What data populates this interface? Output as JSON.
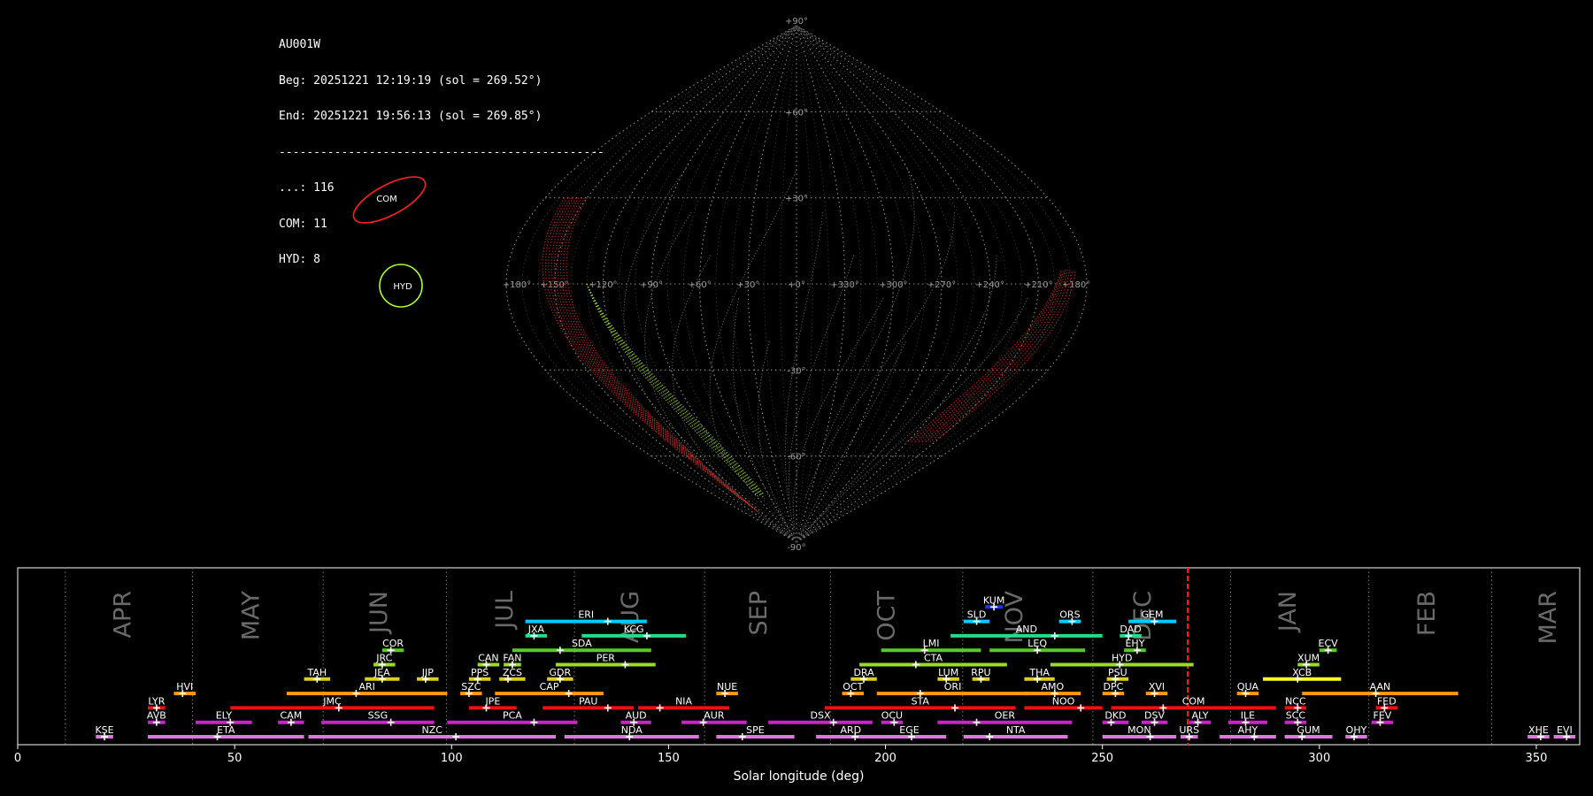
{
  "info": {
    "station": "AU001W",
    "begin": "Beg: 20251221 12:19:19 (sol = 269.52°)",
    "end": "End: 20251221 19:56:13 (sol = 269.85°)",
    "separator": "-----------------------------------------------",
    "counts": [
      "...: 116",
      "COM: 11",
      "HYD: 8"
    ]
  },
  "sky_map": {
    "projection": "sinusoidal",
    "lat_labels": [
      "+90°",
      "+60°",
      "+30°",
      "-30°",
      "-60°",
      "-90°"
    ],
    "lon_labels": [
      "+180°",
      "+150°",
      "+120°",
      "+90°",
      "+60°",
      "+30°",
      "+0°",
      "+330°",
      "+300°",
      "+270°",
      "+240°",
      "+210°",
      "+180°"
    ],
    "radiants": [
      {
        "name": "COM",
        "color": "#ff2020"
      },
      {
        "name": "HYD",
        "color": "#aaff33"
      }
    ]
  },
  "chart_data": {
    "type": "gantt",
    "xlabel": "Solar longitude (deg)",
    "xlim": [
      0,
      360
    ],
    "xticks": [
      0,
      50,
      100,
      150,
      200,
      250,
      300,
      350
    ],
    "current_sol": 269.68,
    "months": [
      {
        "name": "APR",
        "label_x": 24.5,
        "boundary": 11
      },
      {
        "name": "MAY",
        "label_x": 54,
        "boundary": 40.3
      },
      {
        "name": "JUN",
        "label_x": 83.5,
        "boundary": 70.4
      },
      {
        "name": "JUL",
        "label_x": 112.5,
        "boundary": 98.8
      },
      {
        "name": "AUG",
        "label_x": 141.5,
        "boundary": 128.3
      },
      {
        "name": "SEP",
        "label_x": 171,
        "boundary": 158.3
      },
      {
        "name": "OCT",
        "label_x": 200.5,
        "boundary": 187.3
      },
      {
        "name": "NOV",
        "label_x": 230,
        "boundary": 217.8
      },
      {
        "name": "DEC",
        "label_x": 259.5,
        "boundary": 247.8
      },
      {
        "name": "JAN",
        "label_x": 293,
        "boundary": 279.5
      },
      {
        "name": "FEB",
        "label_x": 325,
        "boundary": 311.4
      },
      {
        "name": "MAR",
        "label_x": 353,
        "boundary": 339.7
      }
    ],
    "showers": [
      {
        "code": "KUM",
        "row": 9,
        "start": 223,
        "end": 227,
        "peak": 225,
        "color": "#2233ff"
      },
      {
        "code": "ERI",
        "row": 8,
        "start": 117,
        "end": 145,
        "peak": 136,
        "color": "#00ccff"
      },
      {
        "code": "SLD",
        "row": 8,
        "start": 218,
        "end": 224,
        "peak": 221,
        "color": "#00ccff"
      },
      {
        "code": "ORS",
        "row": 8,
        "start": 240,
        "end": 245,
        "peak": 243,
        "color": "#00ccff"
      },
      {
        "code": "GEM",
        "row": 8,
        "start": 256,
        "end": 267,
        "peak": 262,
        "color": "#00ccff"
      },
      {
        "code": "JXA",
        "row": 7,
        "start": 117,
        "end": 122,
        "peak": 119,
        "color": "#22dd88"
      },
      {
        "code": "KCG",
        "row": 7,
        "start": 130,
        "end": 154,
        "peak": 145,
        "color": "#22dd88"
      },
      {
        "code": "AND",
        "row": 7,
        "start": 215,
        "end": 250,
        "peak": 239,
        "color": "#22dd88"
      },
      {
        "code": "DAD",
        "row": 7,
        "start": 254,
        "end": 259,
        "peak": 256,
        "color": "#22dd88"
      },
      {
        "code": "COR",
        "row": 6,
        "start": 84,
        "end": 89,
        "peak": 86,
        "color": "#55cc22"
      },
      {
        "code": "SDA",
        "row": 6,
        "start": 114,
        "end": 146,
        "peak": 125,
        "color": "#55cc22"
      },
      {
        "code": "LMI",
        "row": 6,
        "start": 199,
        "end": 222,
        "peak": 209,
        "color": "#55cc22"
      },
      {
        "code": "LEQ",
        "row": 6,
        "start": 224,
        "end": 246,
        "peak": 235,
        "color": "#55cc22"
      },
      {
        "code": "EHY",
        "row": 6,
        "start": 255,
        "end": 260,
        "peak": 258,
        "color": "#55cc22"
      },
      {
        "code": "ECV",
        "row": 6,
        "start": 300,
        "end": 304,
        "peak": 302,
        "color": "#55cc22"
      },
      {
        "code": "JRC",
        "row": 5,
        "start": 82,
        "end": 87,
        "peak": 84,
        "color": "#99dd22"
      },
      {
        "code": "CAN",
        "row": 5,
        "start": 106,
        "end": 111,
        "peak": 108,
        "color": "#99dd22"
      },
      {
        "code": "FAN",
        "row": 5,
        "start": 112,
        "end": 116,
        "peak": 114,
        "color": "#99dd22"
      },
      {
        "code": "PER",
        "row": 5,
        "start": 124,
        "end": 147,
        "peak": 140,
        "color": "#99dd22"
      },
      {
        "code": "CTA",
        "row": 5,
        "start": 194,
        "end": 228,
        "peak": 207,
        "color": "#99dd22"
      },
      {
        "code": "HYD",
        "row": 5,
        "start": 238,
        "end": 271,
        "peak": 254,
        "color": "#99dd22"
      },
      {
        "code": "XUM",
        "row": 5,
        "start": 295,
        "end": 300,
        "peak": 297,
        "color": "#99dd22"
      },
      {
        "code": "TAH",
        "row": 4,
        "start": 66,
        "end": 72,
        "peak": 69,
        "color": "#ddcc22"
      },
      {
        "code": "JEA",
        "row": 4,
        "start": 80,
        "end": 88,
        "peak": 84,
        "color": "#ddcc22"
      },
      {
        "code": "JIP",
        "row": 4,
        "start": 92,
        "end": 97,
        "peak": 94,
        "color": "#ddcc22"
      },
      {
        "code": "PPS",
        "row": 4,
        "start": 104,
        "end": 109,
        "peak": 106,
        "color": "#ddcc22"
      },
      {
        "code": "ZCS",
        "row": 4,
        "start": 111,
        "end": 117,
        "peak": 113,
        "color": "#ddcc22"
      },
      {
        "code": "GDR",
        "row": 4,
        "start": 122,
        "end": 128,
        "peak": 125,
        "color": "#ddcc22"
      },
      {
        "code": "DRA",
        "row": 4,
        "start": 192,
        "end": 198,
        "peak": 195,
        "color": "#ddcc22"
      },
      {
        "code": "LUM",
        "row": 4,
        "start": 212,
        "end": 217,
        "peak": 214,
        "color": "#ddcc22"
      },
      {
        "code": "RPU",
        "row": 4,
        "start": 220,
        "end": 224,
        "peak": 222,
        "color": "#ddcc22"
      },
      {
        "code": "THA",
        "row": 4,
        "start": 232,
        "end": 239,
        "peak": 235,
        "color": "#ddcc22"
      },
      {
        "code": "PSU",
        "row": 4,
        "start": 251,
        "end": 256,
        "peak": 253,
        "color": "#ddcc22"
      },
      {
        "code": "XCB",
        "row": 4,
        "start": 287,
        "end": 305,
        "peak": 295,
        "color": "#ffff22"
      },
      {
        "code": "HVI",
        "row": 3,
        "start": 36,
        "end": 41,
        "peak": 38,
        "color": "#ff9911"
      },
      {
        "code": "ARI",
        "row": 3,
        "start": 62,
        "end": 99,
        "peak": 78,
        "color": "#ff9911"
      },
      {
        "code": "SZC",
        "row": 3,
        "start": 102,
        "end": 107,
        "peak": 104,
        "color": "#ff9911"
      },
      {
        "code": "CAP",
        "row": 3,
        "start": 110,
        "end": 135,
        "peak": 127,
        "color": "#ff9911"
      },
      {
        "code": "NUE",
        "row": 3,
        "start": 161,
        "end": 166,
        "peak": 163,
        "color": "#ff9911"
      },
      {
        "code": "OCT",
        "row": 3,
        "start": 190,
        "end": 195,
        "peak": 192,
        "color": "#ff9911"
      },
      {
        "code": "ORI",
        "row": 3,
        "start": 198,
        "end": 233,
        "peak": 208,
        "color": "#ff9911"
      },
      {
        "code": "AMO",
        "row": 3,
        "start": 232,
        "end": 245,
        "peak": 239,
        "color": "#ff9911"
      },
      {
        "code": "DPC",
        "row": 3,
        "start": 250,
        "end": 255,
        "peak": 253,
        "color": "#ff9911"
      },
      {
        "code": "XVI",
        "row": 3,
        "start": 260,
        "end": 265,
        "peak": 262,
        "color": "#ff9911"
      },
      {
        "code": "QUA",
        "row": 3,
        "start": 281,
        "end": 286,
        "peak": 283,
        "color": "#ff9911"
      },
      {
        "code": "AAN",
        "row": 3,
        "start": 296,
        "end": 332,
        "peak": 313,
        "color": "#ff9911"
      },
      {
        "code": "LYR",
        "row": 2,
        "start": 30,
        "end": 34,
        "peak": 32,
        "color": "#ee1111"
      },
      {
        "code": "JMC",
        "row": 2,
        "start": 49,
        "end": 96,
        "peak": 74,
        "color": "#ee1111"
      },
      {
        "code": "JPE",
        "row": 2,
        "start": 104,
        "end": 115,
        "peak": 108,
        "color": "#ee1111"
      },
      {
        "code": "PAU",
        "row": 2,
        "start": 121,
        "end": 142,
        "peak": 136,
        "color": "#ee1111"
      },
      {
        "code": "NIA",
        "row": 2,
        "start": 143,
        "end": 164,
        "peak": 148,
        "color": "#ee1111"
      },
      {
        "code": "STA",
        "row": 2,
        "start": 186,
        "end": 230,
        "peak": 216,
        "color": "#ee1111"
      },
      {
        "code": "NOO",
        "row": 2,
        "start": 232,
        "end": 250,
        "peak": 245,
        "color": "#ee1111"
      },
      {
        "code": "COM",
        "row": 2,
        "start": 252,
        "end": 290,
        "peak": 264,
        "color": "#ee1111"
      },
      {
        "code": "NCC",
        "row": 2,
        "start": 292,
        "end": 297,
        "peak": 295,
        "color": "#ee1111"
      },
      {
        "code": "FED",
        "row": 2,
        "start": 313,
        "end": 318,
        "peak": 315,
        "color": "#ee1111"
      },
      {
        "code": "AVB",
        "row": 1,
        "start": 30,
        "end": 34,
        "peak": 32,
        "color": "#cc22cc"
      },
      {
        "code": "ELY",
        "row": 1,
        "start": 41,
        "end": 54,
        "peak": 49,
        "color": "#cc22cc"
      },
      {
        "code": "CAM",
        "row": 1,
        "start": 60,
        "end": 66,
        "peak": 63,
        "color": "#cc22cc"
      },
      {
        "code": "SSG",
        "row": 1,
        "start": 70,
        "end": 96,
        "peak": 86,
        "color": "#cc22cc"
      },
      {
        "code": "PCA",
        "row": 1,
        "start": 99,
        "end": 129,
        "peak": 119,
        "color": "#cc22cc"
      },
      {
        "code": "AUD",
        "row": 1,
        "start": 139,
        "end": 146,
        "peak": 142,
        "color": "#cc22cc"
      },
      {
        "code": "AUR",
        "row": 1,
        "start": 153,
        "end": 168,
        "peak": 158,
        "color": "#cc22cc"
      },
      {
        "code": "DSX",
        "row": 1,
        "start": 173,
        "end": 197,
        "peak": 188,
        "color": "#cc22cc"
      },
      {
        "code": "OCU",
        "row": 1,
        "start": 199,
        "end": 204,
        "peak": 202,
        "color": "#cc22cc"
      },
      {
        "code": "OER",
        "row": 1,
        "start": 212,
        "end": 243,
        "peak": 221,
        "color": "#cc22cc"
      },
      {
        "code": "DKD",
        "row": 1,
        "start": 250,
        "end": 256,
        "peak": 252,
        "color": "#cc22cc"
      },
      {
        "code": "DSV",
        "row": 1,
        "start": 259,
        "end": 265,
        "peak": 262,
        "color": "#cc22cc"
      },
      {
        "code": "ALY",
        "row": 1,
        "start": 270,
        "end": 275,
        "peak": 272,
        "color": "#cc22cc"
      },
      {
        "code": "ILE",
        "row": 1,
        "start": 279,
        "end": 288,
        "peak": 283,
        "color": "#cc22cc"
      },
      {
        "code": "SCC",
        "row": 1,
        "start": 292,
        "end": 297,
        "peak": 295,
        "color": "#cc22cc"
      },
      {
        "code": "FEV",
        "row": 1,
        "start": 312,
        "end": 317,
        "peak": 314,
        "color": "#cc22cc"
      },
      {
        "code": "KSE",
        "row": 0,
        "start": 18,
        "end": 22,
        "peak": 20,
        "color": "#dd77dd"
      },
      {
        "code": "ETA",
        "row": 0,
        "start": 30,
        "end": 66,
        "peak": 46,
        "color": "#dd77dd"
      },
      {
        "code": "NZC",
        "row": 0,
        "start": 67,
        "end": 124,
        "peak": 101,
        "color": "#dd77dd"
      },
      {
        "code": "NDA",
        "row": 0,
        "start": 126,
        "end": 157,
        "peak": 141,
        "color": "#dd77dd"
      },
      {
        "code": "SPE",
        "row": 0,
        "start": 161,
        "end": 179,
        "peak": 167,
        "color": "#dd77dd"
      },
      {
        "code": "ARD",
        "row": 0,
        "start": 184,
        "end": 200,
        "peak": 193,
        "color": "#dd77dd"
      },
      {
        "code": "EGE",
        "row": 0,
        "start": 197,
        "end": 214,
        "peak": 206,
        "color": "#dd77dd"
      },
      {
        "code": "NTA",
        "row": 0,
        "start": 218,
        "end": 242,
        "peak": 224,
        "color": "#dd77dd"
      },
      {
        "code": "MON",
        "row": 0,
        "start": 250,
        "end": 267,
        "peak": 261,
        "color": "#dd77dd"
      },
      {
        "code": "URS",
        "row": 0,
        "start": 268,
        "end": 272,
        "peak": 270,
        "color": "#dd77dd"
      },
      {
        "code": "AHY",
        "row": 0,
        "start": 277,
        "end": 290,
        "peak": 285,
        "color": "#dd77dd"
      },
      {
        "code": "GUM",
        "row": 0,
        "start": 292,
        "end": 303,
        "peak": 296,
        "color": "#dd77dd"
      },
      {
        "code": "OHY",
        "row": 0,
        "start": 306,
        "end": 311,
        "peak": 308,
        "color": "#dd77dd"
      },
      {
        "code": "XHE",
        "row": 0,
        "start": 348,
        "end": 353,
        "peak": 351,
        "color": "#dd77dd"
      },
      {
        "code": "EVI",
        "row": 0,
        "start": 354,
        "end": 359,
        "peak": 357,
        "color": "#dd77dd"
      }
    ]
  }
}
